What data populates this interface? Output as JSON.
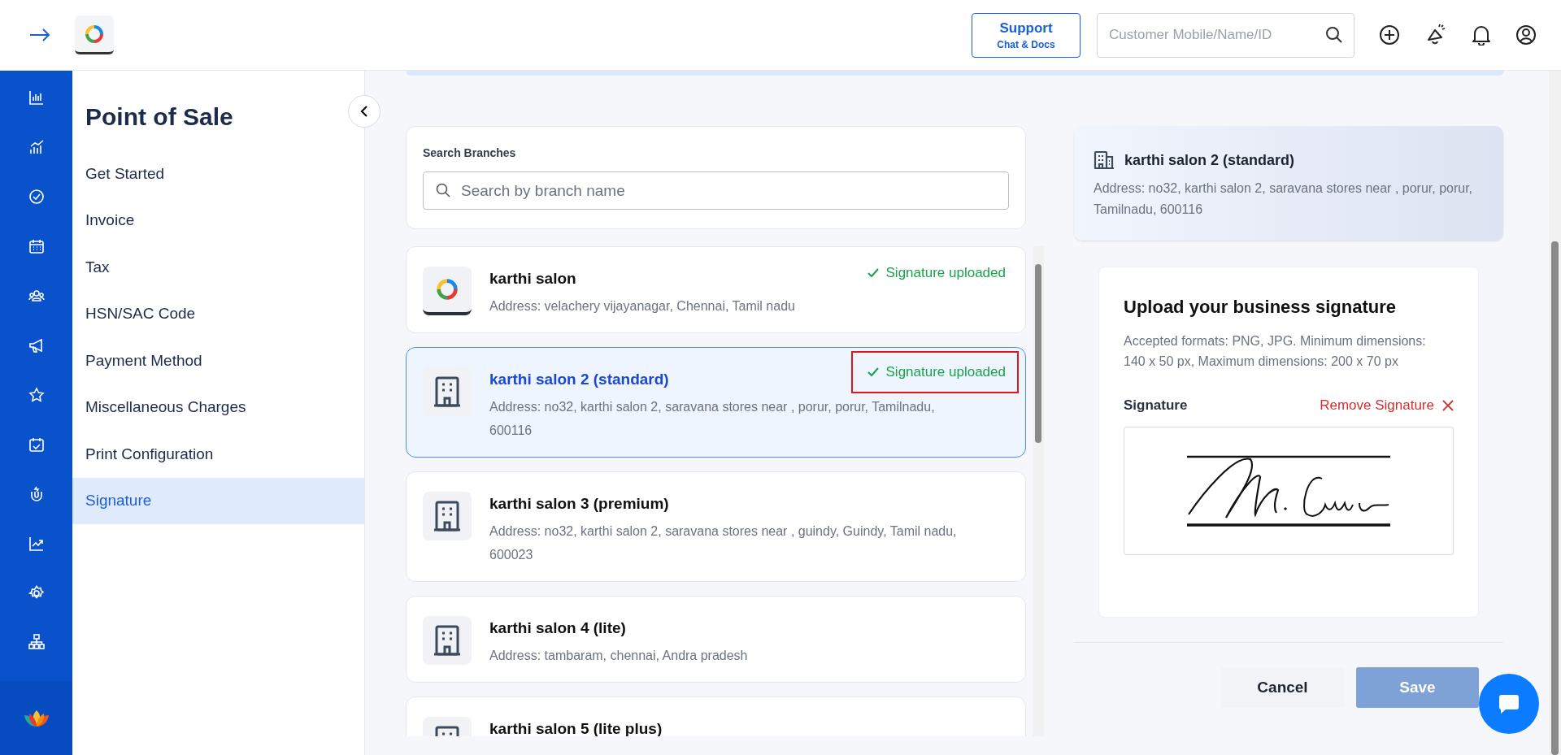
{
  "topbar": {
    "support_button": {
      "title": "Support",
      "subtitle": "Chat & Docs"
    },
    "search": {
      "placeholder": "Customer Mobile/Name/ID"
    }
  },
  "sidebar": {
    "title": "Point of Sale",
    "items": [
      {
        "label": "Get Started",
        "selected": false
      },
      {
        "label": "Invoice",
        "selected": false
      },
      {
        "label": "Tax",
        "selected": false
      },
      {
        "label": "HSN/SAC Code",
        "selected": false
      },
      {
        "label": "Payment Method",
        "selected": false
      },
      {
        "label": "Miscellaneous Charges",
        "selected": false
      },
      {
        "label": "Print Configuration",
        "selected": false
      },
      {
        "label": "Signature",
        "selected": true
      }
    ]
  },
  "branch_search": {
    "label": "Search Branches",
    "placeholder": "Search by branch name"
  },
  "branches": [
    {
      "kind": "logo",
      "name": "karthi salon",
      "address": "Address: velachery vijayanagar, Chennai, Tamil nadu",
      "status": "Signature uploaded",
      "selected": false,
      "highlighted": false
    },
    {
      "kind": "building",
      "name": "karthi salon 2 (standard)",
      "address": "Address: no32, karthi salon 2, saravana stores near , porur, porur, Tamilnadu, 600116",
      "status": "Signature uploaded",
      "selected": true,
      "highlighted": true
    },
    {
      "kind": "building",
      "name": "karthi salon 3 (premium)",
      "address": "Address: no32, karthi salon 2, saravana stores near , guindy, Guindy, Tamil nadu, 600023",
      "selected": false
    },
    {
      "kind": "building",
      "name": "karthi salon 4 (lite)",
      "address": "Address: tambaram, chennai, Andra pradesh",
      "selected": false
    },
    {
      "kind": "building",
      "name": "karthi salon 5 (lite plus)",
      "selected": false
    }
  ],
  "details": {
    "name": "karthi salon 2 (standard)",
    "address": "Address: no32, karthi salon 2, saravana stores near , porur, porur, Tamilnadu, 600116"
  },
  "upload": {
    "title": "Upload your business signature",
    "hint": "Accepted formats: PNG, JPG. Minimum dimensions: 140 x 50 px, Maximum dimensions: 200 x 70 px",
    "field_label": "Signature",
    "remove_link": "Remove Signature"
  },
  "actions": {
    "cancel": "Cancel",
    "save": "Save",
    "save_disabled": true
  }
}
